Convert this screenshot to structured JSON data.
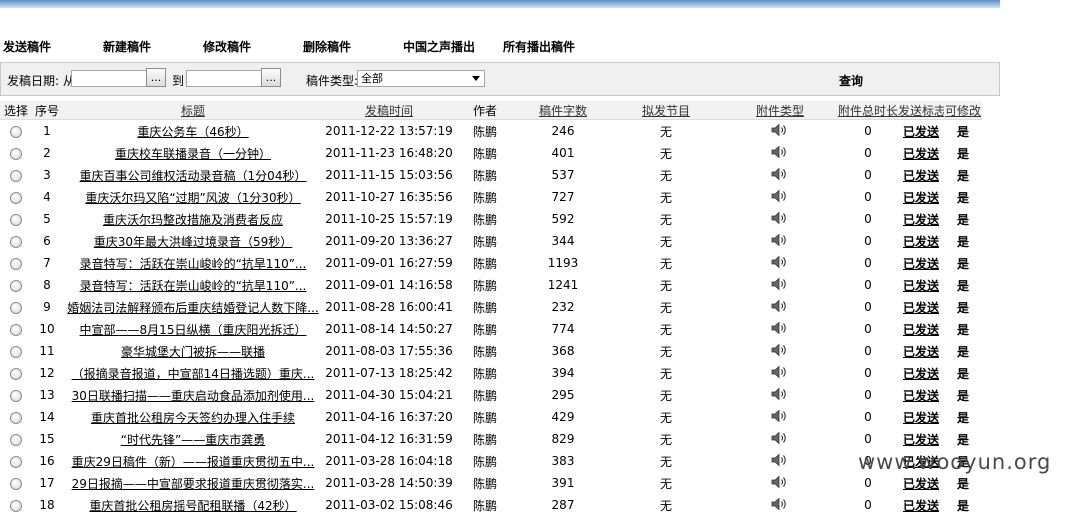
{
  "toolbar": {
    "send": "发送稿件",
    "new": "新建稿件",
    "edit": "修改稿件",
    "delete": "删除稿件",
    "cnr": "中国之声播出",
    "all_aired": "所有播出稿件"
  },
  "filter": {
    "date_label": "发稿日期: 从",
    "to_label": "到",
    "picker_label": "...",
    "date_from": "",
    "date_to": "",
    "type_label": "稿件类型:",
    "type_value": "全部",
    "query": "查询"
  },
  "table": {
    "headers": {
      "select": "选择",
      "seq": "序号",
      "title": "标题",
      "time": "发稿时间",
      "author": "作者",
      "chars": "稿件字数",
      "program": "拟发节目",
      "attach_type": "附件类型",
      "attach_len": "附件总时长",
      "sent_flag": "发送标志",
      "editable": "可修改"
    },
    "rows": [
      {
        "seq": "1",
        "title": "重庆公务车（46秒）",
        "time": "2011-12-22 13:57:19",
        "author": "陈鹏",
        "chars": "246",
        "program": "无",
        "attach": "speaker-icon",
        "duration": "0",
        "sent": "已发送",
        "editable": "是"
      },
      {
        "seq": "2",
        "title": "重庆校车联播录音（一分钟）",
        "time": "2011-11-23 16:48:20",
        "author": "陈鹏",
        "chars": "401",
        "program": "无",
        "attach": "speaker-icon",
        "duration": "0",
        "sent": "已发送",
        "editable": "是"
      },
      {
        "seq": "3",
        "title": "重庆百事公司维权活动录音稿（1分04秒）",
        "time": "2011-11-15 15:03:56",
        "author": "陈鹏",
        "chars": "537",
        "program": "无",
        "attach": "speaker-icon",
        "duration": "0",
        "sent": "已发送",
        "editable": "是"
      },
      {
        "seq": "4",
        "title": "重庆沃尔玛又陷“过期”风波（1分30秒）",
        "time": "2011-10-27 16:35:56",
        "author": "陈鹏",
        "chars": "727",
        "program": "无",
        "attach": "speaker-icon",
        "duration": "0",
        "sent": "已发送",
        "editable": "是"
      },
      {
        "seq": "5",
        "title": "重庆沃尔玛整改措施及消费者反应",
        "time": "2011-10-25 15:57:19",
        "author": "陈鹏",
        "chars": "592",
        "program": "无",
        "attach": "speaker-icon",
        "duration": "0",
        "sent": "已发送",
        "editable": "是"
      },
      {
        "seq": "6",
        "title": "重庆30年最大洪峰过境录音（59秒）",
        "time": "2011-09-20 13:36:27",
        "author": "陈鹏",
        "chars": "344",
        "program": "无",
        "attach": "speaker-icon",
        "duration": "0",
        "sent": "已发送",
        "editable": "是"
      },
      {
        "seq": "7",
        "title": "录音特写：活跃在崇山峻岭的“抗旱110”...",
        "time": "2011-09-01 16:27:59",
        "author": "陈鹏",
        "chars": "1193",
        "program": "无",
        "attach": "speaker-icon",
        "duration": "0",
        "sent": "已发送",
        "editable": "是"
      },
      {
        "seq": "8",
        "title": "录音特写：活跃在崇山峻岭的“抗旱110”...",
        "time": "2011-09-01 14:16:58",
        "author": "陈鹏",
        "chars": "1241",
        "program": "无",
        "attach": "speaker-icon",
        "duration": "0",
        "sent": "已发送",
        "editable": "是"
      },
      {
        "seq": "9",
        "title": "婚姻法司法解释颁布后重庆结婚登记人数下降...",
        "time": "2011-08-28 16:00:41",
        "author": "陈鹏",
        "chars": "232",
        "program": "无",
        "attach": "speaker-icon",
        "duration": "0",
        "sent": "已发送",
        "editable": "是"
      },
      {
        "seq": "10",
        "title": "中宣部——8月15日纵横（重庆阳光拆迁）",
        "time": "2011-08-14 14:50:27",
        "author": "陈鹏",
        "chars": "774",
        "program": "无",
        "attach": "speaker-icon",
        "duration": "0",
        "sent": "已发送",
        "editable": "是"
      },
      {
        "seq": "11",
        "title": "豪华城堡大门被拆——联播",
        "time": "2011-08-03 17:55:36",
        "author": "陈鹏",
        "chars": "368",
        "program": "无",
        "attach": "speaker-icon",
        "duration": "0",
        "sent": "已发送",
        "editable": "是"
      },
      {
        "seq": "12",
        "title": "（报摘录音报道，中宣部14日播选题）重庆...",
        "time": "2011-07-13 18:25:42",
        "author": "陈鹏",
        "chars": "394",
        "program": "无",
        "attach": "speaker-icon",
        "duration": "0",
        "sent": "已发送",
        "editable": "是"
      },
      {
        "seq": "13",
        "title": "30日联播扫描——重庆启动食品添加剂使用...",
        "time": "2011-04-30 15:04:21",
        "author": "陈鹏",
        "chars": "295",
        "program": "无",
        "attach": "speaker-icon",
        "duration": "0",
        "sent": "已发送",
        "editable": "是"
      },
      {
        "seq": "14",
        "title": "重庆首批公租房今天签约办理入住手续",
        "time": "2011-04-16 16:37:20",
        "author": "陈鹏",
        "chars": "429",
        "program": "无",
        "attach": "speaker-icon",
        "duration": "0",
        "sent": "已发送",
        "editable": "是"
      },
      {
        "seq": "15",
        "title": "“时代先锋”——重庆市龚勇",
        "time": "2011-04-12 16:31:59",
        "author": "陈鹏",
        "chars": "829",
        "program": "无",
        "attach": "speaker-icon",
        "duration": "0",
        "sent": "已发送",
        "editable": "是"
      },
      {
        "seq": "16",
        "title": "重庆29日稿件（新）——报道重庆贯彻五中...",
        "time": "2011-03-28 16:04:18",
        "author": "陈鹏",
        "chars": "383",
        "program": "无",
        "attach": "speaker-icon",
        "duration": "0",
        "sent": "已发送",
        "editable": "是"
      },
      {
        "seq": "17",
        "title": "29日报摘——中宣部要求报道重庆贯彻落实...",
        "time": "2011-03-28 14:50:39",
        "author": "陈鹏",
        "chars": "391",
        "program": "无",
        "attach": "speaker-icon",
        "duration": "0",
        "sent": "已发送",
        "editable": "是"
      },
      {
        "seq": "18",
        "title": "重庆首批公租房摇号配租联播（42秒）",
        "time": "2011-03-02 15:08:46",
        "author": "陈鹏",
        "chars": "287",
        "program": "无",
        "attach": "speaker-icon",
        "duration": "0",
        "sent": "已发送",
        "editable": "是"
      }
    ]
  },
  "watermark": "www.wooyun.org"
}
